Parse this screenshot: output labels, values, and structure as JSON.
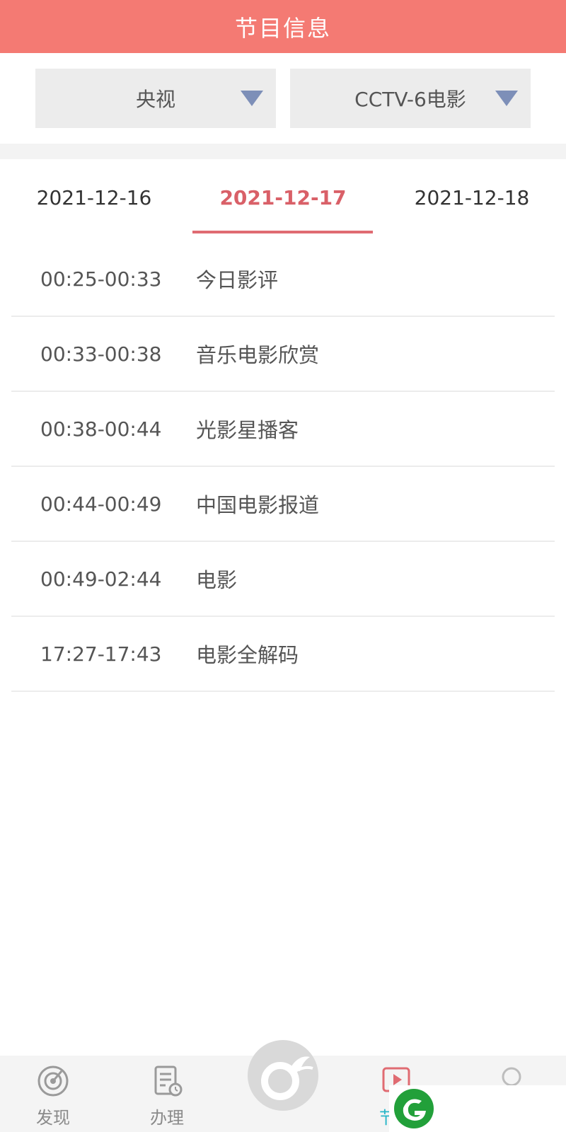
{
  "header": {
    "title": "节目信息"
  },
  "filters": {
    "provider": {
      "selected": "央视"
    },
    "channel": {
      "selected": "CCTV-6电影"
    }
  },
  "date_tabs": [
    {
      "label": "2021-12-16",
      "active": false
    },
    {
      "label": "2021-12-17",
      "active": true
    },
    {
      "label": "2021-12-18",
      "active": false
    }
  ],
  "programs": [
    {
      "time": "00:25-00:33",
      "name": "今日影评"
    },
    {
      "time": "00:33-00:38",
      "name": "音乐电影欣赏"
    },
    {
      "time": "00:38-00:44",
      "name": "光影星播客"
    },
    {
      "time": "00:44-00:49",
      "name": "中国电影报道"
    },
    {
      "time": "00:49-02:44",
      "name": "电影"
    },
    {
      "time": "17:27-17:43",
      "name": "电影全解码"
    }
  ],
  "bottom_nav": [
    {
      "label": "发现",
      "icon": "discover-icon"
    },
    {
      "label": "办理",
      "icon": "document-clock-icon"
    },
    {
      "label": "",
      "icon": "center-logo-icon"
    },
    {
      "label": "节目",
      "icon": "play-icon"
    },
    {
      "label": "",
      "icon": "search-icon"
    }
  ],
  "colors": {
    "header_bg": "#f47a73",
    "active_tab": "#d96068",
    "active_nav": "#27b6c8",
    "dropdown_arrow": "#7d8fb8"
  }
}
